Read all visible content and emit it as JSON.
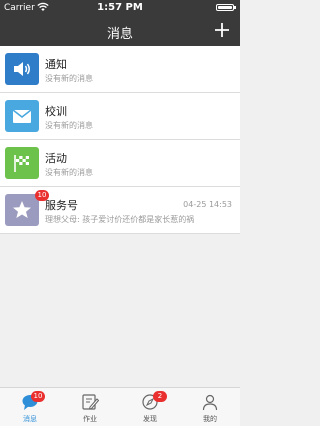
{
  "status": {
    "carrier": "Carrier",
    "time": "1:57 PM"
  },
  "nav": {
    "title": "消息",
    "add_icon": "plus-icon"
  },
  "rows": [
    {
      "name": "通知",
      "sub": "没有新的消息",
      "icon": "speaker-icon",
      "color": "#2f7dc9"
    },
    {
      "name": "校训",
      "sub": "没有新的消息",
      "icon": "envelope-icon",
      "color": "#4aa8e0"
    },
    {
      "name": "活动",
      "sub": "没有新的消息",
      "icon": "flag-icon",
      "color": "#6cc24a"
    },
    {
      "name": "服务号",
      "sub": "理想父母: 孩子爱讨价还价都是家长惹的祸",
      "time": "04-25 14:53",
      "badge": "10",
      "icon": "star-icon",
      "color": "#9b9bc0"
    }
  ],
  "tabs": [
    {
      "label": "消息",
      "badge": "10",
      "icon": "chat-bubble-icon",
      "active": true
    },
    {
      "label": "作业",
      "icon": "edit-icon",
      "active": false
    },
    {
      "label": "发现",
      "badge": "2",
      "icon": "compass-icon",
      "active": false
    },
    {
      "label": "我的",
      "icon": "person-icon",
      "active": false
    }
  ],
  "colors": {
    "bar": "#3a3a3a",
    "badge": "#e9302f",
    "accent": "#2e8fd8"
  }
}
